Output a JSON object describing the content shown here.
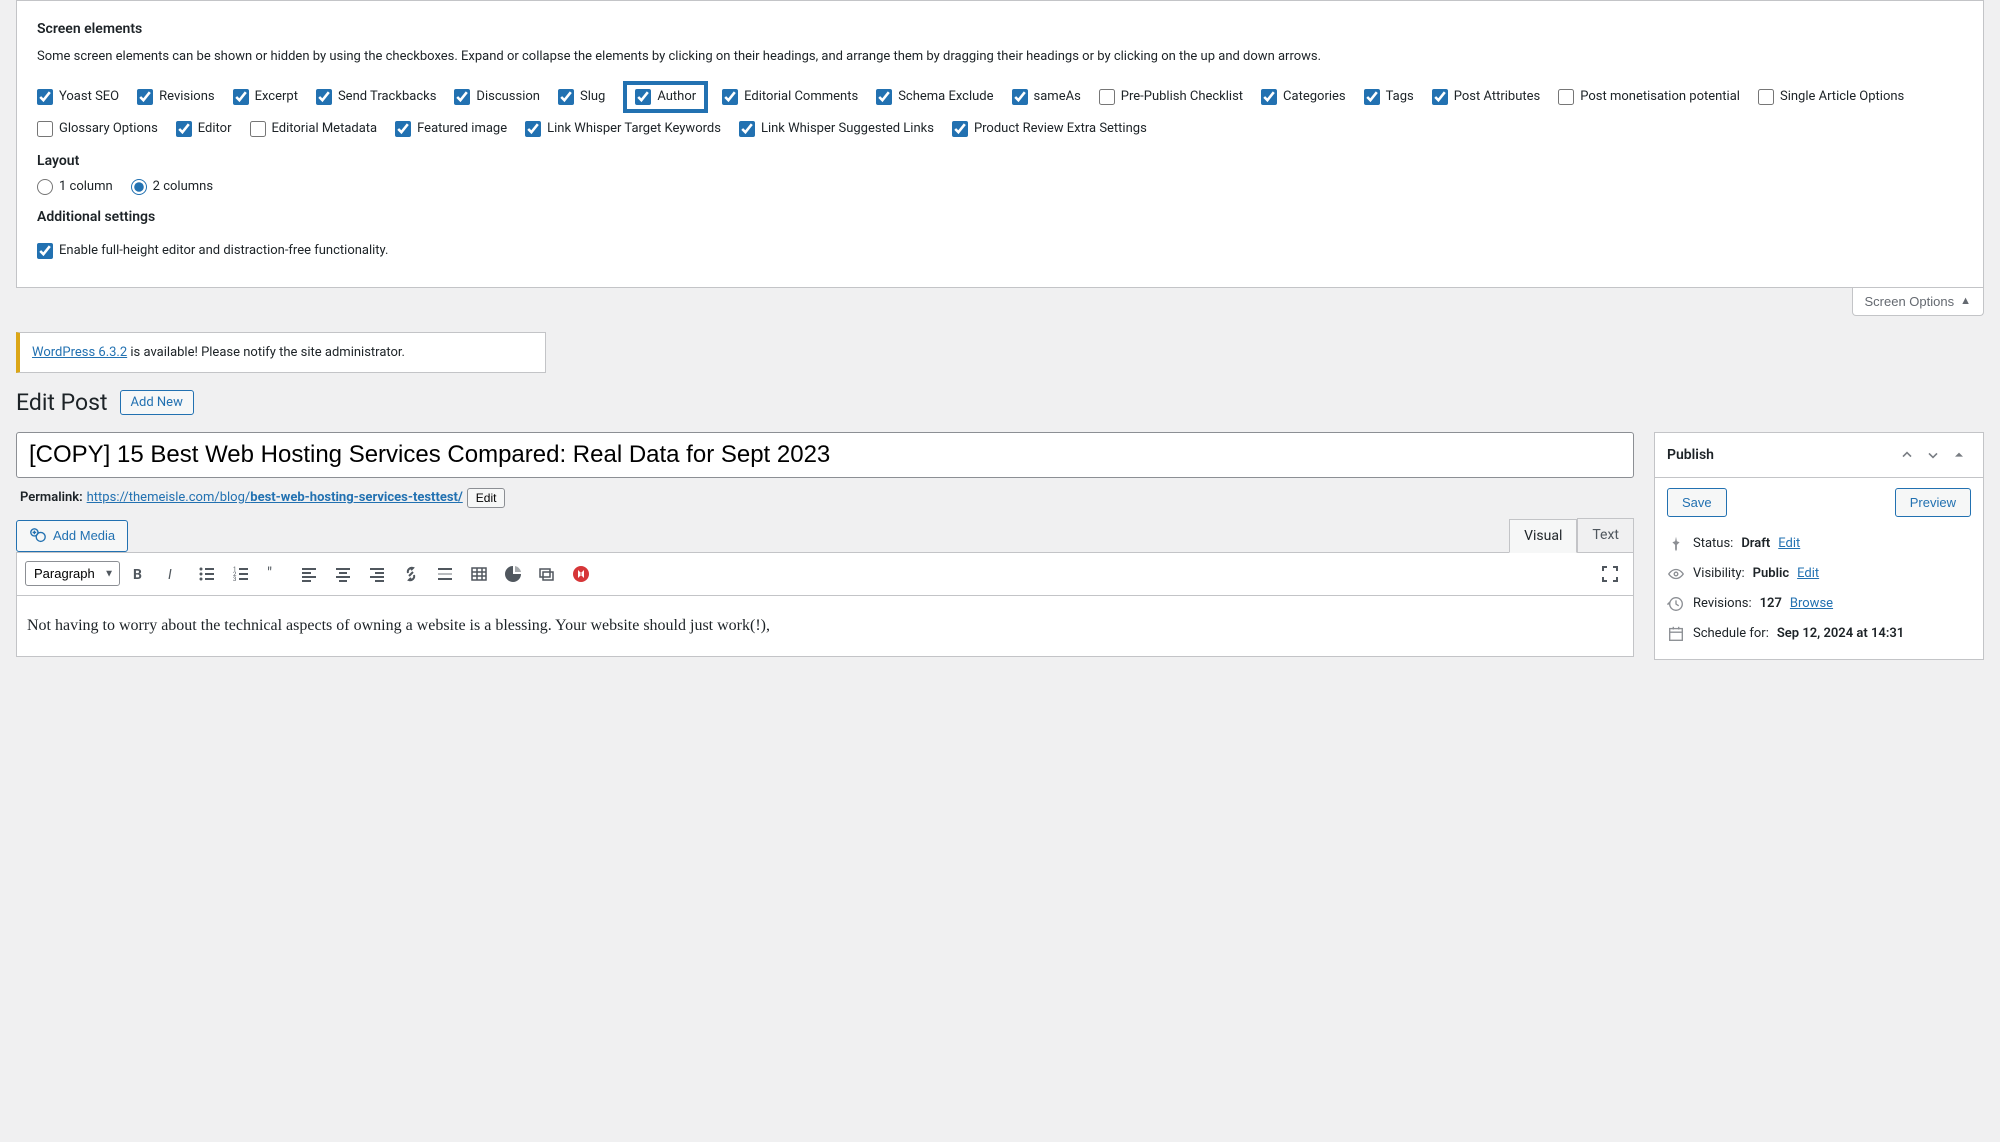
{
  "screen_options": {
    "heading_elements": "Screen elements",
    "desc": "Some screen elements can be shown or hidden by using the checkboxes. Expand or collapse the elements by clicking on their headings, and arrange them by dragging their headings or by clicking on the up and down arrows.",
    "checkboxes": {
      "yoast_seo": "Yoast SEO",
      "revisions": "Revisions",
      "excerpt": "Excerpt",
      "send_trackbacks": "Send Trackbacks",
      "discussion": "Discussion",
      "slug": "Slug",
      "author": "Author",
      "editorial_comments": "Editorial Comments",
      "schema_exclude": "Schema Exclude",
      "sameas": "sameAs",
      "pre_publish_checklist": "Pre-Publish Checklist",
      "categories": "Categories",
      "tags": "Tags",
      "post_attributes": "Post Attributes",
      "post_monetisation": "Post monetisation potential",
      "single_article_options": "Single Article Options",
      "glossary_options": "Glossary Options",
      "editor": "Editor",
      "editorial_metadata": "Editorial Metadata",
      "featured_image": "Featured image",
      "link_whisper_target": "Link Whisper Target Keywords",
      "link_whisper_suggested": "Link Whisper Suggested Links",
      "product_review": "Product Review Extra Settings"
    },
    "heading_layout": "Layout",
    "layout_options": {
      "col1": "1 column",
      "col2": "2 columns"
    },
    "heading_additional": "Additional settings",
    "full_height": "Enable full-height editor and distraction-free functionality.",
    "tab_label": "Screen Options"
  },
  "notice": {
    "link_text": "WordPress 6.3.2",
    "suffix": " is available! Please notify the site administrator."
  },
  "page": {
    "title": "Edit Post",
    "add_new": "Add New"
  },
  "post": {
    "title_value": "[COPY] 15 Best Web Hosting Services Compared: Real Data for Sept 2023",
    "permalink_label": "Permalink:",
    "permalink_base": "https://themeisle.com/blog/",
    "permalink_slug": "best-web-hosting-services-testtest/",
    "permalink_edit": "Edit",
    "add_media": "Add Media",
    "tab_visual": "Visual",
    "tab_text": "Text",
    "format_dropdown": "Paragraph",
    "content": "Not having to worry about the technical aspects of owning a website is a blessing. Your website should just work(!),"
  },
  "publish": {
    "heading": "Publish",
    "save": "Save",
    "preview": "Preview",
    "status_label": "Status:",
    "status_value": "Draft",
    "status_edit": "Edit",
    "visibility_label": "Visibility:",
    "visibility_value": "Public",
    "visibility_edit": "Edit",
    "revisions_label": "Revisions:",
    "revisions_value": "127",
    "revisions_browse": "Browse",
    "schedule_label": "Schedule for:",
    "schedule_value": "Sep 12, 2024 at 14:31"
  }
}
